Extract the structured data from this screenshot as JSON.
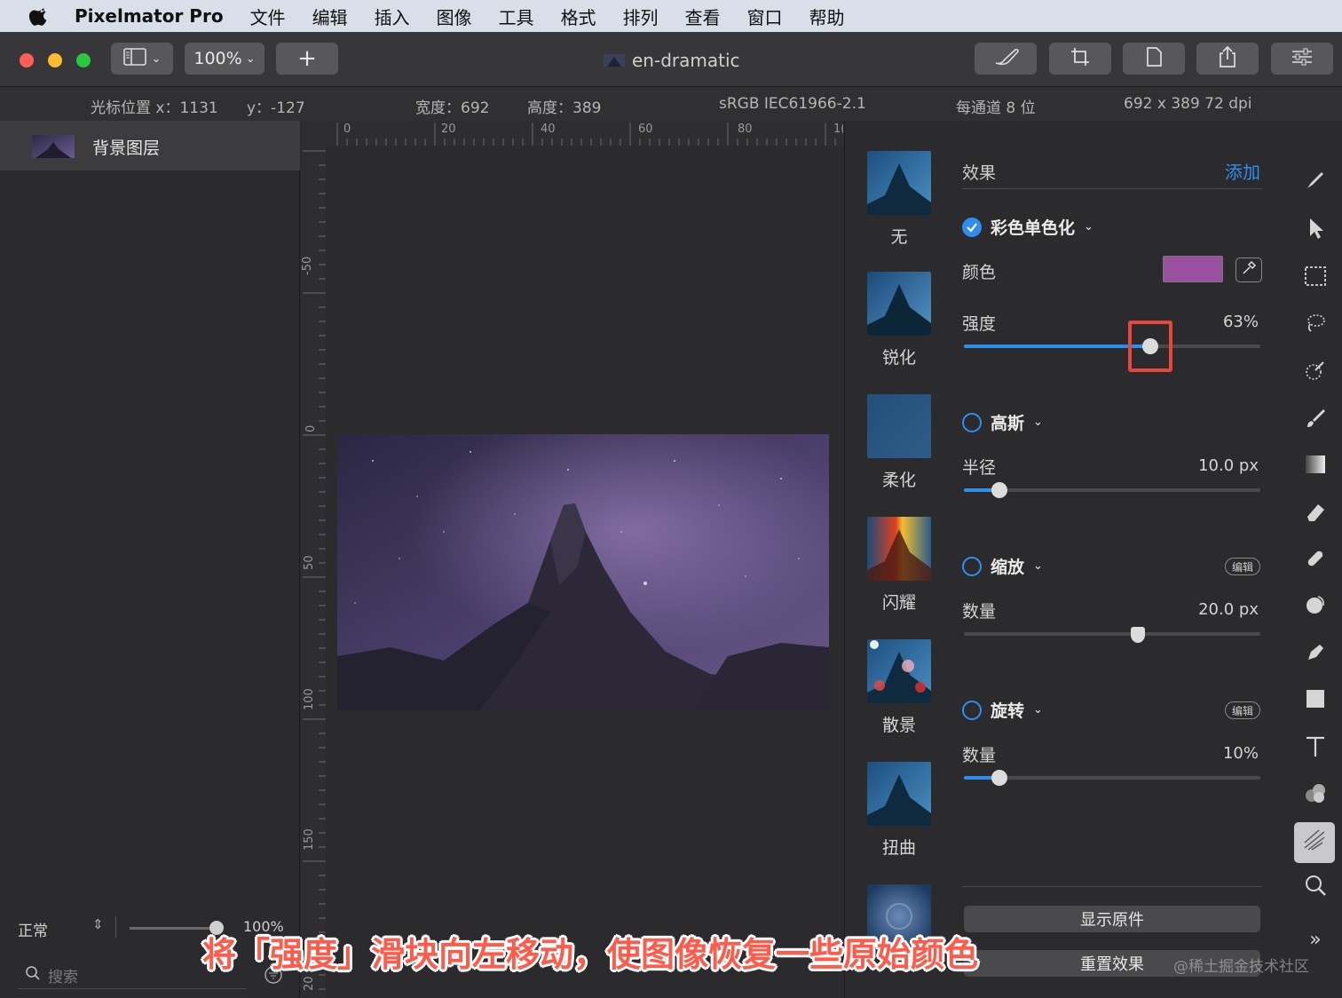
{
  "menubar": {
    "app_name": "Pixelmator Pro",
    "items": [
      "文件",
      "编辑",
      "插入",
      "图像",
      "工具",
      "格式",
      "排列",
      "查看",
      "窗口",
      "帮助"
    ]
  },
  "toolbar": {
    "zoom": "100%",
    "add_label": "+",
    "doc_title": "en-dramatic"
  },
  "infobar": {
    "cursor_x": "光标位置 x：1131",
    "cursor_y": "y：-127",
    "width": "宽度：692",
    "height": "高度：389",
    "color_profile": "sRGB IEC61966-2.1",
    "bit_depth": "每通道 8 位",
    "size_dpi": "692 x 389 72 dpi"
  },
  "layers": {
    "layer_name": "背景图层",
    "blend_mode": "正常",
    "opacity": "100%",
    "search_placeholder": "搜索"
  },
  "ruler": {
    "top_ticks": [
      "0",
      "20",
      "40",
      "60",
      "80",
      "1("
    ],
    "left_ticks": [
      "-50",
      "0",
      "50",
      "100",
      "150",
      "20"
    ]
  },
  "effects_list": {
    "items": [
      "无",
      "锐化",
      "柔化",
      "闪耀",
      "散景",
      "扭曲"
    ]
  },
  "settings": {
    "section_title": "效果",
    "add_label": "添加",
    "color_mono": {
      "name": "彩色单色化",
      "enabled": true,
      "color_label": "颜色",
      "color_value": "#9a4fa0",
      "intensity_label": "强度",
      "intensity_value": "63%",
      "intensity_fraction": 0.63
    },
    "gaussian": {
      "name": "高斯",
      "enabled": false,
      "radius_label": "半径",
      "radius_value": "10.0 px",
      "radius_fraction": 0.12
    },
    "zoom": {
      "name": "缩放",
      "enabled": false,
      "edit_label": "编辑",
      "amount_label": "数量",
      "amount_value": "20.0 px",
      "amount_fraction": 0.59
    },
    "rotate": {
      "name": "旋转",
      "enabled": false,
      "edit_label": "编辑",
      "amount_label": "数量",
      "amount_value": "10%",
      "amount_fraction": 0.12
    },
    "show_original": "显示原件",
    "reset_effects": "重置效果"
  },
  "caption": "将「强度」滑块向左移动，使图像恢复一些原始颜色",
  "watermark": "@稀土掘金技术社区",
  "colors": {
    "accent": "#2e8ef0",
    "highlight": "#e8453c"
  }
}
